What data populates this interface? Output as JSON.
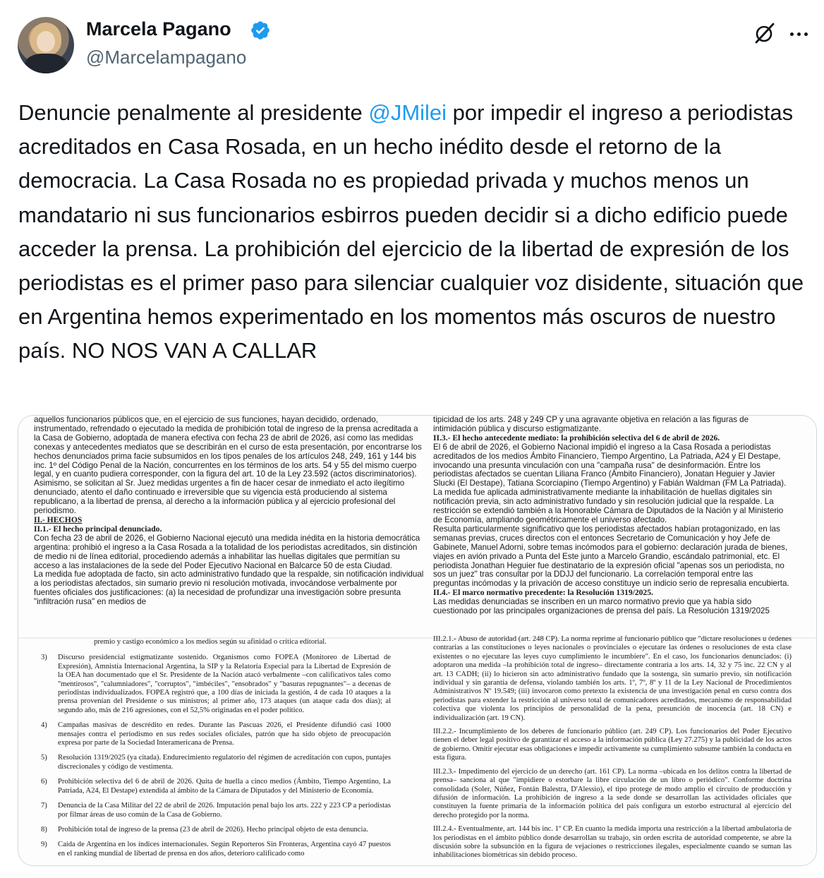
{
  "author": {
    "name": "Marcela Pagano",
    "handle": "@Marcelampagano",
    "verified_color": "#1d9bf0"
  },
  "actions": {
    "grok_icon": "grok-slash-icon",
    "more_icon": "more-horizontal-icon"
  },
  "tweet": {
    "text_before": "Denuncie penalmente al presidente ",
    "mention": "@JMilei",
    "text_after": " por impedir el ingreso a periodistas acreditados en Casa Rosada, en un hecho inédito desde el retorno de la democracia. La Casa Rosada no es propiedad privada y muchos menos un mandatario ni sus funcionarios esbirros pueden decidir si a dicho edificio puede acceder la prensa. La prohibición del ejercicio de la libertad de expresión de los periodistas es el primer paso para silenciar cualquier voz disidente, situación que en Argentina hemos experimentado en los momentos más oscuros de nuestro país. NO NOS VAN A CALLAR",
    "mention_color": "#1d9bf0"
  },
  "document": {
    "top_left": [
      "aquellos funcionarios públicos que, en el ejercicio de sus funciones, hayan decidido, ordenado, instrumentado, refrendado o ejecutado la medida de prohibición total de ingreso de la prensa acreditada a la Casa de Gobierno, adoptada de manera efectiva con fecha 23 de abril de 2026, así como las medidas conexas y antecedentes mediatos que se describirán en el curso de esta presentación, por encontrarse los hechos denunciados prima facie subsumidos en los tipos penales de los artículos 248, 249, 161 y 144 bis inc. 1º del Código Penal de la Nación, concurrentes en los términos de los arts. 54 y 55 del mismo cuerpo legal, y en cuanto pudiera corresponder, con la figura del art. 10 de la Ley 23.592 (actos discriminatorios).",
      "Asimismo, se solicitan al Sr. Juez medidas urgentes a fin de hacer cesar de inmediato el acto ilegítimo denunciado, atento el daño continuado e irreversible que su vigencia está produciendo al sistema republicano, a la libertad de prensa, al derecho a la información pública y al ejercicio profesional del periodismo.",
      "II.- HECHOS",
      "II.1.- El hecho principal denunciado.",
      "Con fecha 23 de abril de 2026, el Gobierno Nacional ejecutó una medida inédita en la historia democrática argentina: prohibió el ingreso a la Casa Rosada a la totalidad de los periodistas acreditados, sin distinción de medio ni de línea editorial, procediendo además a inhabilitar las huellas digitales que permitían su acceso a las instalaciones de la sede del Poder Ejecutivo Nacional en Balcarce 50 de esta Ciudad.",
      "La medida fue adoptada de facto, sin acto administrativo fundado que la respalde, sin notificación individual a los periodistas afectados, sin sumario previo ni resolución motivada, invocándose verbalmente por fuentes oficiales dos justificaciones: (a) la necesidad de profundizar una investigación sobre presunta \"infiltración rusa\" en medios de"
    ],
    "top_right": [
      "tipicidad de los arts. 248 y 249 CP y una agravante objetiva en relación a las figuras de intimidación pública y discurso estigmatizante.",
      "II.3.- El hecho antecedente mediato: la prohibición selectiva del 6 de abril de 2026.",
      "El 6 de abril de 2026, el Gobierno Nacional impidió el ingreso a la Casa Rosada a periodistas acreditados de los medios Ámbito Financiero, Tiempo Argentino, La Patriada, A24 y El Destape, invocando una presunta vinculación con una \"campaña rusa\" de desinformación. Entre los periodistas afectados se cuentan Liliana Franco (Ámbito Financiero), Jonatan Heguier y Javier Slucki (El Destape), Tatiana Scorciapino (Tiempo Argentino) y Fabián Waldman (FM La Patriada).",
      "La medida fue aplicada administrativamente mediante la inhabilitación de huellas digitales sin notificación previa, sin acto administrativo fundado y sin resolución judicial que la respalde. La restricción se extendió también a la Honorable Cámara de Diputados de la Nación y al Ministerio de Economía, ampliando geométricamente el universo afectado.",
      "Resulta particularmente significativo que los periodistas afectados habían protagonizado, en las semanas previas, cruces directos con el entonces Secretario de Comunicación y hoy Jefe de Gabinete, Manuel Adorni, sobre temas incómodos para el gobierno: declaración jurada de bienes, viajes en avión privado a Punta del Este junto a Marcelo Grandio, escándalo patrimonial, etc. El periodista Jonathan Heguier fue destinatario de la expresión oficial \"apenas sos un periodista, no sos un juez\" tras consultar por la DDJJ del funcionario. La correlación temporal entre las preguntas incómodas y la privación de acceso constituye un indicio serio de represalia encubierta.",
      "II.4.- El marco normativo precedente: la Resolución 1319/2025.",
      "Las medidas denunciadas se inscriben en un marco normativo previo que ya había sido cuestionado por las principales organizaciones de prensa del país. La Resolución 1319/2025"
    ],
    "bottom_left_intro": "premio y castigo económico a los medios según su afinidad o crítica editorial.",
    "bottom_left_items": [
      {
        "num": "3)",
        "text": "Discurso presidencial estigmatizante sostenido. Organismos como FOPEA (Monitoreo de Libertad de Expresión), Amnistía Internacional Argentina, la SIP y la Relatoría Especial para la Libertad de Expresión de la OEA han documentado que el Sr. Presidente de la Nación atacó verbalmente –con calificativos tales como \"mentirosos\", \"calumniadores\", \"corruptos\", \"imbéciles\", \"ensobrados\" y \"basuras repugnantes\"– a decenas de periodistas individualizados. FOPEA registró que, a 100 días de iniciada la gestión, 4 de cada 10 ataques a la prensa provenían del Presidente o sus ministros; al primer año, 173 ataques (un ataque cada dos días); al segundo año, más de 216 agresiones, con el 52,5% originadas en el poder político."
      },
      {
        "num": "4)",
        "text": "Campañas masivas de descrédito en redes. Durante las Pascuas 2026, el Presidente difundió casi 1000 mensajes contra el periodismo en sus redes sociales oficiales, patrón que ha sido objeto de preocupación expresa por parte de la Sociedad Interamericana de Prensa."
      },
      {
        "num": "5)",
        "text": "Resolución 1319/2025 (ya citada). Endurecimiento regulatorio del régimen de acreditación con cupos, puntajes discrecionales y código de vestimenta."
      },
      {
        "num": "6)",
        "text": "Prohibición selectiva del 6 de abril de 2026. Quita de huella a cinco medios (Ámbito, Tiempo Argentino, La Patriada, A24, El Destape) extendida al ámbito de la Cámara de Diputados y del Ministerio de Economía."
      },
      {
        "num": "7)",
        "text": "Denuncia de la Casa Militar del 22 de abril de 2026. Imputación penal bajo los arts. 222 y 223 CP a periodistas por filmar áreas de uso común de la Casa de Gobierno."
      },
      {
        "num": "8)",
        "text": "Prohibición total de ingreso de la prensa (23 de abril de 2026). Hecho principal objeto de esta denuncia."
      },
      {
        "num": "9)",
        "text": "Caída de Argentina en los índices internacionales. Según Reporteros Sin Fronteras, Argentina cayó 47 puestos en el ranking mundial de libertad de prensa en dos años, deterioro calificado como"
      }
    ],
    "bottom_right": [
      "III.2.1.- Abuso de autoridad (art. 248 CP). La norma reprime al funcionario público que \"dictare resoluciones u órdenes contrarias a las constituciones o leyes nacionales o provinciales o ejecutare las órdenes o resoluciones de esta clase existentes o no ejecutare las leyes cuyo cumplimiento le incumbiere\". En el caso, los funcionarios denunciados: (i) adoptaron una medida –la prohibición total de ingreso– directamente contraria a los arts. 14, 32 y 75 inc. 22 CN y al art. 13 CADH; (ii) lo hicieron sin acto administrativo fundado que la sostenga, sin sumario previo, sin notificación individual y sin garantía de defensa, violando también los arts. 1º, 7º, 8º y 11 de la Ley Nacional de Procedimientos Administrativos Nº 19.549; (iii) invocaron como pretexto la existencia de una investigación penal en curso contra dos periodistas para extender la restricción al universo total de comunicadores acreditados, mecanismo de responsabilidad colectiva que violenta los principios de personalidad de la pena, presunción de inocencia (art. 18 CN) e individualización (art. 19 CN).",
      "III.2.2.- Incumplimiento de los deberes de funcionario público (art. 249 CP). Los funcionarios del Poder Ejecutivo tienen el deber legal positivo de garantizar el acceso a la información pública (Ley 27.275) y la publicidad de los actos de gobierno. Omitir ejecutar esas obligaciones e impedir activamente su cumplimiento subsume también la conducta en esta figura.",
      "III.2.3.- Impedimento del ejercicio de un derecho (art. 161 CP). La norma –ubicada en los delitos contra la libertad de prensa– sanciona al que \"impidiere o estorbare la libre circulación de un libro o periódico\". Conforme doctrina consolidada (Soler, Núñez, Fontán Balestra, D'Alessio), el tipo protege de modo amplio el circuito de producción y difusión de información. La prohibición de ingreso a la sede donde se desarrollan las actividades oficiales que constituyen la fuente primaria de la información política del país configura un estorbo estructural al ejercicio del derecho protegido por la norma.",
      "III.2.4.- Eventualmente, art. 144 bis inc. 1º CP. En cuanto la medida importa una restricción a la libertad ambulatoria de los periodistas en el ámbito público donde desarrollan su trabajo, sin orden escrita de autoridad competente, se abre la discusión sobre la subsunción en la figura de vejaciones o restricciones ilegales, especialmente cuando se suman las inhabilitaciones biométricas sin debido proceso."
    ]
  }
}
